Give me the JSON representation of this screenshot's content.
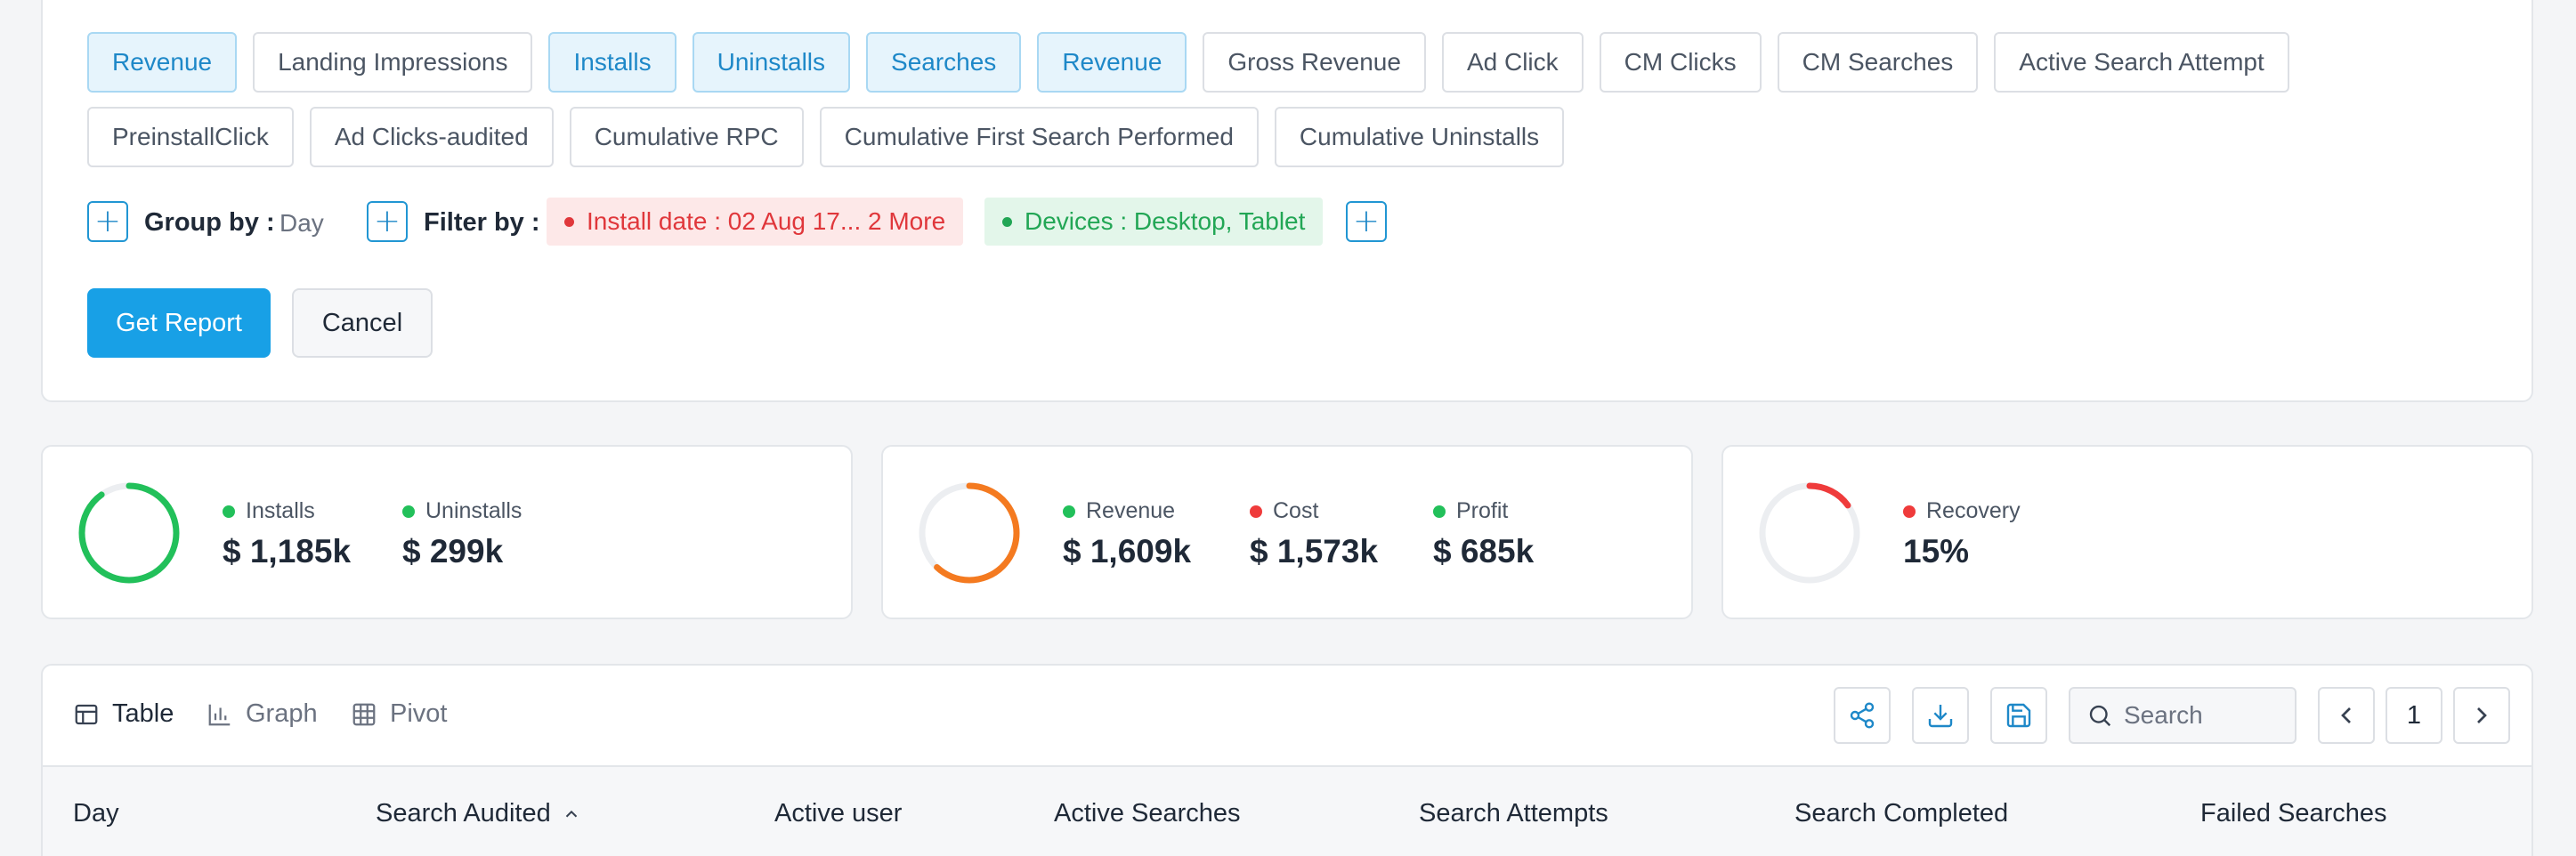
{
  "metrics": {
    "row1": [
      {
        "label": "Revenue",
        "selected": true
      },
      {
        "label": "Landing Impressions",
        "selected": false
      },
      {
        "label": "Installs",
        "selected": true
      },
      {
        "label": "Uninstalls",
        "selected": true
      },
      {
        "label": "Searches",
        "selected": true
      },
      {
        "label": "Revenue",
        "selected": true
      },
      {
        "label": "Gross Revenue",
        "selected": false
      },
      {
        "label": "Ad Click",
        "selected": false
      },
      {
        "label": "CM Clicks",
        "selected": false
      },
      {
        "label": "CM Searches",
        "selected": false
      },
      {
        "label": "Active Search Attempt",
        "selected": false
      }
    ],
    "row2": [
      {
        "label": "PreinstallClick",
        "selected": false
      },
      {
        "label": "Ad Clicks-audited",
        "selected": false
      },
      {
        "label": "Cumulative RPC",
        "selected": false
      },
      {
        "label": "Cumulative First Search Performed",
        "selected": false
      },
      {
        "label": "Cumulative Uninstalls",
        "selected": false
      }
    ]
  },
  "group_by": {
    "label": "Group by :",
    "value": "Day"
  },
  "filter_by": {
    "label": "Filter by :",
    "tags": [
      {
        "text": "Install date : 02 Aug 17... 2 More",
        "color": "red"
      },
      {
        "text": "Devices : Desktop, Tablet",
        "color": "green"
      }
    ]
  },
  "actions": {
    "get_report": "Get Report",
    "cancel": "Cancel"
  },
  "summary": [
    {
      "ring": {
        "color": "#22c05a",
        "fraction": 0.9
      },
      "stats": [
        {
          "label": "Installs",
          "value": "$ 1,185k",
          "color": "#22c05a"
        },
        {
          "label": "Uninstalls",
          "value": "$ 299k",
          "color": "#22c05a"
        }
      ]
    },
    {
      "ring": {
        "color": "#f47a20",
        "fraction": 0.62
      },
      "stats": [
        {
          "label": "Revenue",
          "value": "$ 1,609k",
          "color": "#22c05a"
        },
        {
          "label": "Cost",
          "value": "$ 1,573k",
          "color": "#ef3b3b"
        },
        {
          "label": "Profit",
          "value": "$ 685k",
          "color": "#22c05a"
        }
      ]
    },
    {
      "ring": {
        "color": "#ef3b3b",
        "fraction": 0.15
      },
      "stats": [
        {
          "label": "Recovery",
          "value": "15%",
          "color": "#ef3b3b"
        }
      ]
    }
  ],
  "views": {
    "table": "Table",
    "graph": "Graph",
    "pivot": "Pivot"
  },
  "search": {
    "placeholder": "Search"
  },
  "pagination": {
    "page": "1"
  },
  "columns": [
    "Day",
    "Search Audited",
    "Active user",
    "Active Searches",
    "Search Attempts",
    "Search Completed",
    "Failed Searches"
  ]
}
